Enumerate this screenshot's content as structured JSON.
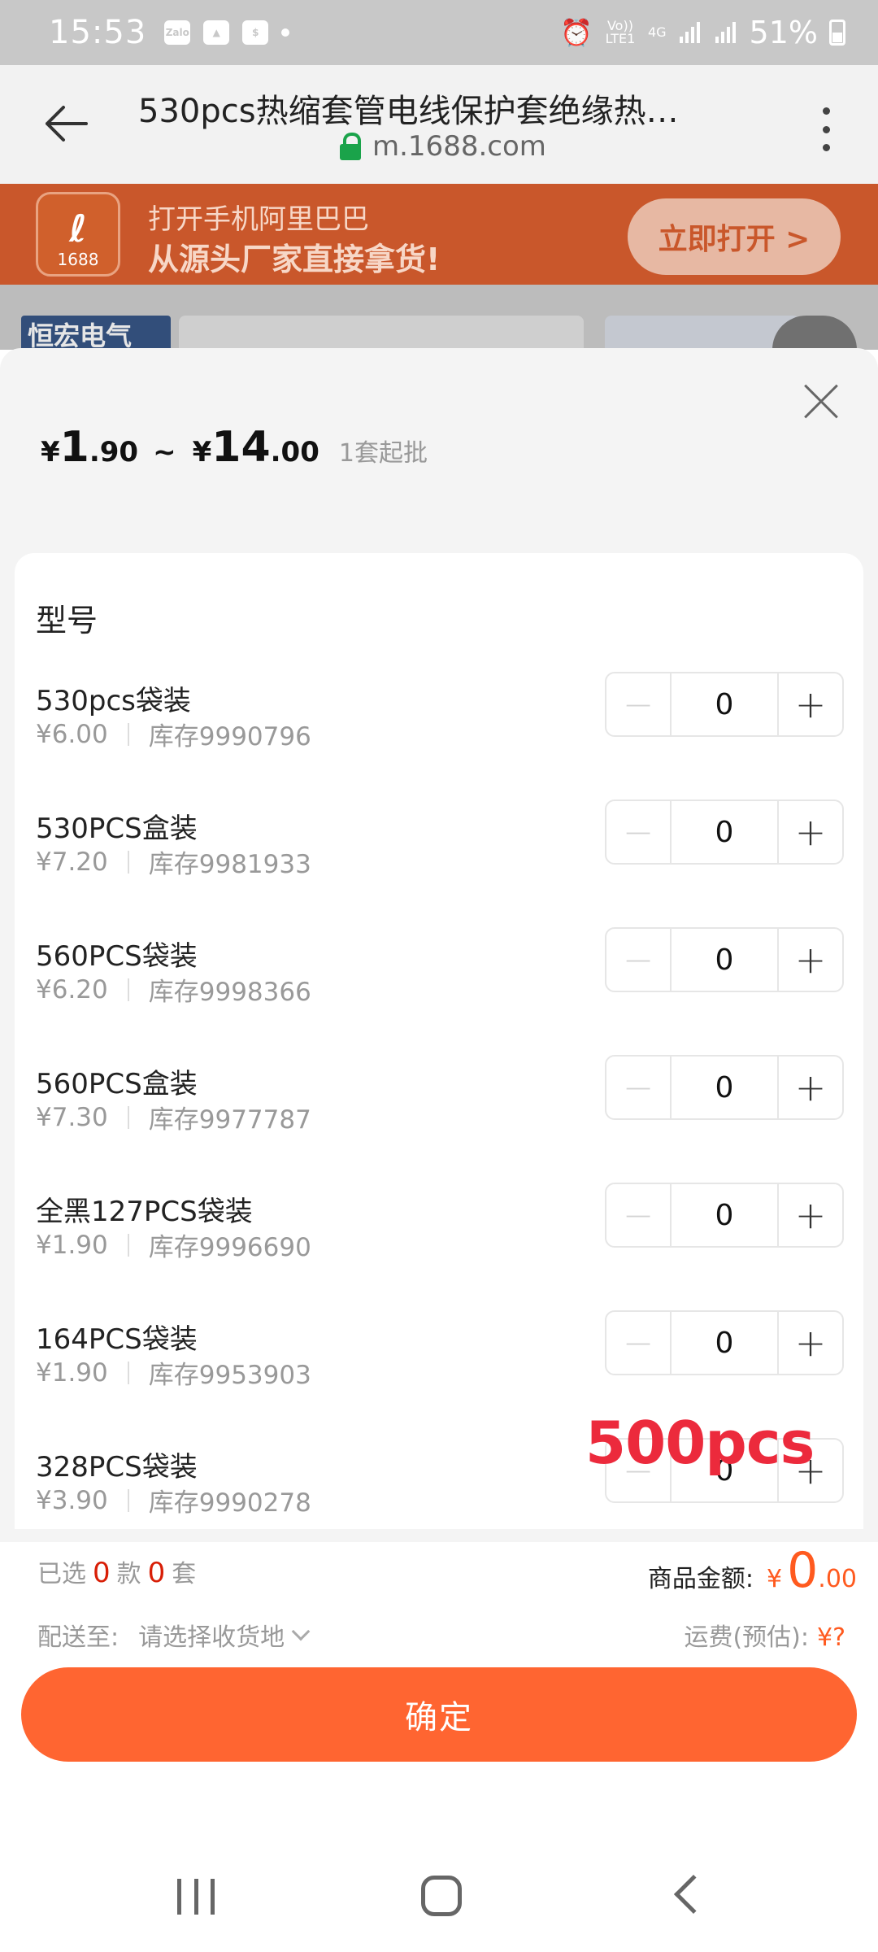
{
  "status_bar": {
    "time": "15:53",
    "left_icons": [
      "zalo-icon",
      "gallery-icon",
      "shield-dollar-icon",
      "dot-icon"
    ],
    "zalo_label": "Zalo",
    "volte_label": "Vo)) LTE1",
    "network_label": "4G",
    "battery_percent": "51%"
  },
  "browser": {
    "title": "530pcs热缩套管电线保护套绝缘热…",
    "url": "m.1688.com"
  },
  "app_banner": {
    "logo_text": "1688",
    "line1": "打开手机阿里巴巴",
    "line2": "从源头厂家直接拿货!",
    "open_button": "立即打开 >"
  },
  "background_page": {
    "shop_tag": "恒宏电气"
  },
  "sheet": {
    "price": {
      "currency": "¥",
      "min_int": "1",
      "min_dec": ".90",
      "separator": "~",
      "max_int": "14",
      "max_dec": ".00",
      "moq": "1套起批"
    },
    "section_title": "型号",
    "skus": [
      {
        "name": "530pcs袋装",
        "price": "¥6.00",
        "stock": "库存9990796",
        "qty": "0"
      },
      {
        "name": "530PCS盒装",
        "price": "¥7.20",
        "stock": "库存9981933",
        "qty": "0"
      },
      {
        "name": "560PCS袋装",
        "price": "¥6.20",
        "stock": "库存9998366",
        "qty": "0"
      },
      {
        "name": "560PCS盒装",
        "price": "¥7.30",
        "stock": "库存9977787",
        "qty": "0"
      },
      {
        "name": "全黑127PCS袋装",
        "price": "¥1.90",
        "stock": "库存9996690",
        "qty": "0"
      },
      {
        "name": "164PCS袋装",
        "price": "¥1.90",
        "stock": "库存9953903",
        "qty": "0"
      },
      {
        "name": "328PCS袋装",
        "price": "¥3.90",
        "stock": "库存9990278",
        "qty": "0"
      }
    ],
    "stepper_minus": "−",
    "stepper_plus": "+",
    "overlay_annotation": "500pcs"
  },
  "footer": {
    "selected_prefix": "已选",
    "selected_kinds": "0",
    "kinds_unit": "款",
    "selected_sets": "0",
    "sets_unit": "套",
    "amount_label": "商品金额:",
    "amount_currency": "¥",
    "amount_int": "0",
    "amount_dec": ".00",
    "ship_label": "配送至:",
    "ship_placeholder": "请选择收货地",
    "freight_label": "运费(预估):",
    "freight_value": "¥?",
    "confirm_button": "确定"
  },
  "colors": {
    "accent_orange": "#ff6531",
    "price_red": "#d81e06",
    "banner_bg": "#c9572b",
    "annotation_red": "#ec2a3c"
  }
}
